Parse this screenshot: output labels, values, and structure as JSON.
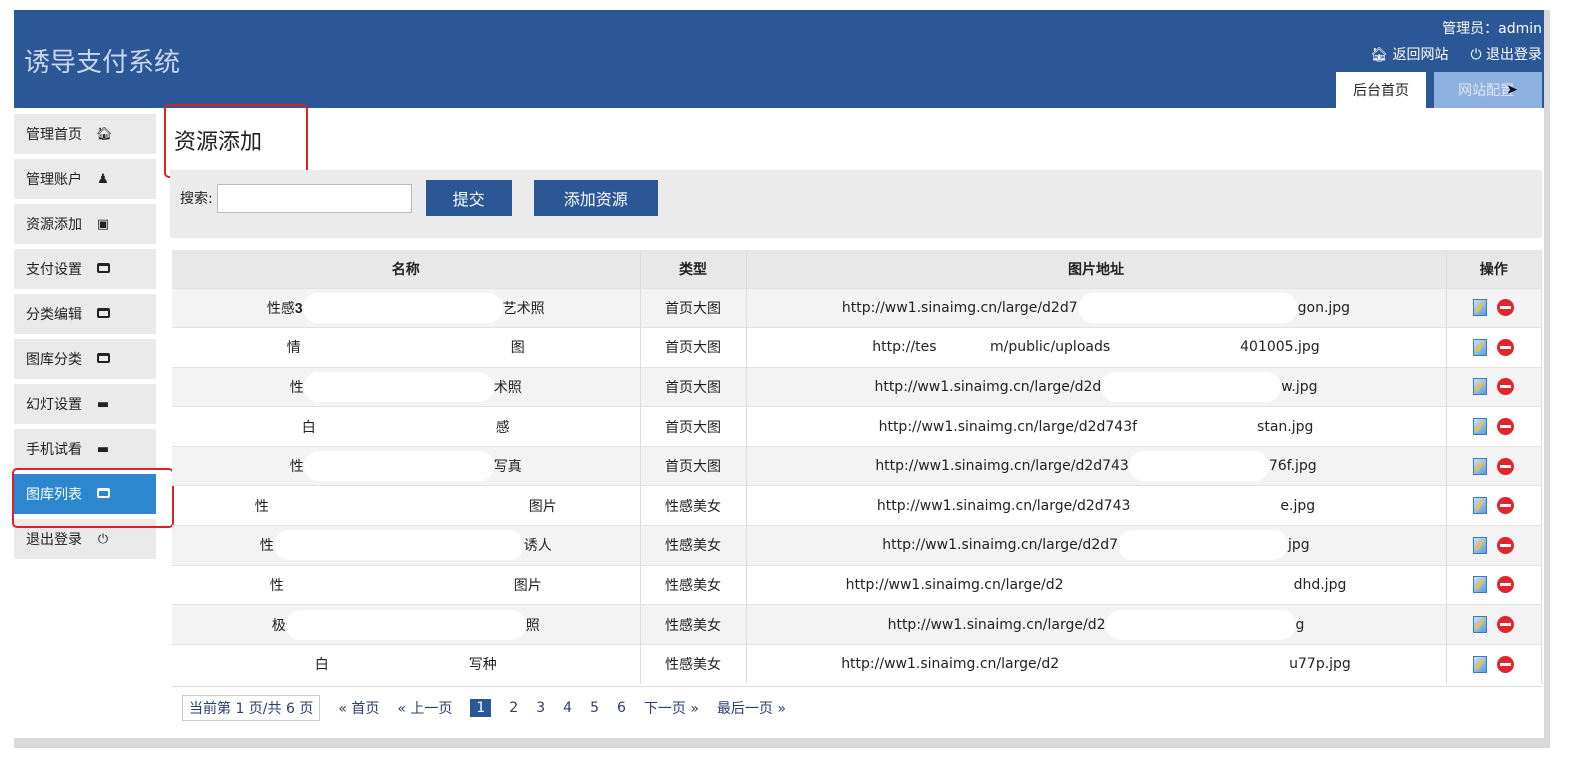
{
  "header": {
    "brand": "诱导支付系统",
    "admin": "管理员：admin",
    "back_site": "返回网站",
    "logout": "退出登录",
    "tabs": [
      "后台首页",
      "网站配置"
    ]
  },
  "sidebar": {
    "items": [
      {
        "label": "管理首页",
        "icon": "home-icon"
      },
      {
        "label": "管理账户",
        "icon": "user-icon"
      },
      {
        "label": "资源添加",
        "icon": "document-icon"
      },
      {
        "label": "支付设置",
        "icon": "window-icon"
      },
      {
        "label": "分类编辑",
        "icon": "window-icon"
      },
      {
        "label": "图库分类",
        "icon": "window-icon"
      },
      {
        "label": "幻灯设置",
        "icon": "folder-icon"
      },
      {
        "label": "手机试看",
        "icon": "folder-icon"
      },
      {
        "label": "图库列表",
        "icon": "window-icon",
        "active": true
      },
      {
        "label": "退出登录",
        "icon": "power-icon"
      }
    ]
  },
  "main": {
    "title": "资源添加",
    "search_label": "搜索:",
    "search_value": "",
    "submit": "提交",
    "add_resource": "添加资源"
  },
  "table": {
    "columns": [
      "名称",
      "类型",
      "图片地址",
      "操作"
    ],
    "rows": [
      {
        "name": [
          "性感𝟑",
          "艺术照"
        ],
        "type": "首页大图",
        "url": [
          "http://ww1.sinaimg.cn/large/d2d7",
          "gon.jpg"
        ]
      },
      {
        "name": [
          "情",
          "图"
        ],
        "type": "首页大图",
        "url": [
          "http://tes            m/public/uploads",
          "401005.jpg"
        ]
      },
      {
        "name": [
          "性",
          "术照"
        ],
        "type": "首页大图",
        "url": [
          "http://ww1.sinaimg.cn/large/d2d",
          "w.jpg"
        ]
      },
      {
        "name": [
          "白",
          "感"
        ],
        "type": "首页大图",
        "url": [
          "http://ww1.sinaimg.cn/large/d2d743f",
          "stan.jpg"
        ]
      },
      {
        "name": [
          "性",
          "写真"
        ],
        "type": "首页大图",
        "url": [
          "http://ww1.sinaimg.cn/large/d2d743",
          "76f.jpg"
        ]
      },
      {
        "name": [
          "性",
          "图片"
        ],
        "type": "性感美女",
        "url": [
          "http://ww1.sinaimg.cn/large/d2d743",
          "e.jpg"
        ]
      },
      {
        "name": [
          "性",
          "诱人"
        ],
        "type": "性感美女",
        "url": [
          "http://ww1.sinaimg.cn/large/d2d7",
          "jpg"
        ]
      },
      {
        "name": [
          "性",
          "图片"
        ],
        "type": "性感美女",
        "url": [
          "http://ww1.sinaimg.cn/large/d2",
          "dhd.jpg"
        ]
      },
      {
        "name": [
          "极",
          "照"
        ],
        "type": "性感美女",
        "url": [
          "http://ww1.sinaimg.cn/large/d2",
          "g"
        ]
      },
      {
        "name": [
          "白",
          "写种"
        ],
        "type": "性感美女",
        "url": [
          "http://ww1.sinaimg.cn/large/d2",
          "u77p.jpg"
        ]
      }
    ]
  },
  "pager": {
    "info": "当前第 1 页/共 6 页",
    "first": "« 首页",
    "prev": "« 上一页",
    "pages": [
      "1",
      "2",
      "3",
      "4",
      "5",
      "6"
    ],
    "next": "下一页 »",
    "last": "最后一页 »"
  }
}
